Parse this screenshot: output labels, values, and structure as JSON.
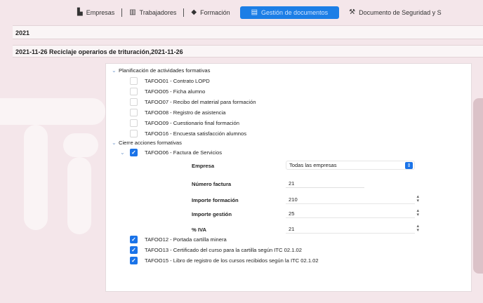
{
  "toolbar": {
    "items": [
      {
        "label": "Empresas",
        "icon": "building-icon"
      },
      {
        "label": "Trabajadores",
        "icon": "workers-icon"
      },
      {
        "label": "Formación",
        "icon": "graduation-cap-icon"
      },
      {
        "label": "Gestión de documentos",
        "icon": "documents-icon"
      },
      {
        "label": "Documento de Seguridad y S",
        "icon": "tools-icon"
      }
    ],
    "active_index": 3
  },
  "year": "2021",
  "title": "2021-11-26 Reciclaje operarios de trituración,2021-11-26",
  "tree": {
    "planificacion": {
      "label": "Planificación de actividades formativas",
      "items": [
        {
          "label": "TAFOO01 - Contrato LOPD",
          "checked": false
        },
        {
          "label": "TAFOO05 - Ficha alumno",
          "checked": false
        },
        {
          "label": "TAFOO07 - Recibo del material para formación",
          "checked": false
        },
        {
          "label": "TAFOO08 - Registro de asistencia",
          "checked": false
        },
        {
          "label": "TAFOO09 - Cuestionario final formación",
          "checked": false
        },
        {
          "label": "TAFOO16 - Encuesta satisfacción alumnos",
          "checked": false
        }
      ]
    },
    "cierre": {
      "label": "Cierre acciones formativas",
      "factura": {
        "label": "TAFOO06 - Factura de Servicios",
        "checked": true
      },
      "form": {
        "empresa_label": "Empresa",
        "empresa_value": "Todas las empresas",
        "numero_label": "Número factura",
        "numero_value": "21",
        "importe_formacion_label": "Importe formación",
        "importe_formacion_value": "210",
        "importe_gestion_label": "Importe gestión",
        "importe_gestion_value": "25",
        "iva_label": "% IVA",
        "iva_value": "21"
      },
      "items": [
        {
          "label": "TAFOO12 - Portada cartilla minera",
          "checked": true
        },
        {
          "label": "TAFOO13 - Certificado del curso para la cartilla según ITC 02.1.02",
          "checked": true
        },
        {
          "label": "TAFOO15 - Libro de registro de los cursos recibidos según la ITC 02.1.02",
          "checked": true
        }
      ]
    }
  },
  "colors": {
    "accent": "#1a73e8",
    "background": "#f4e6ea"
  }
}
